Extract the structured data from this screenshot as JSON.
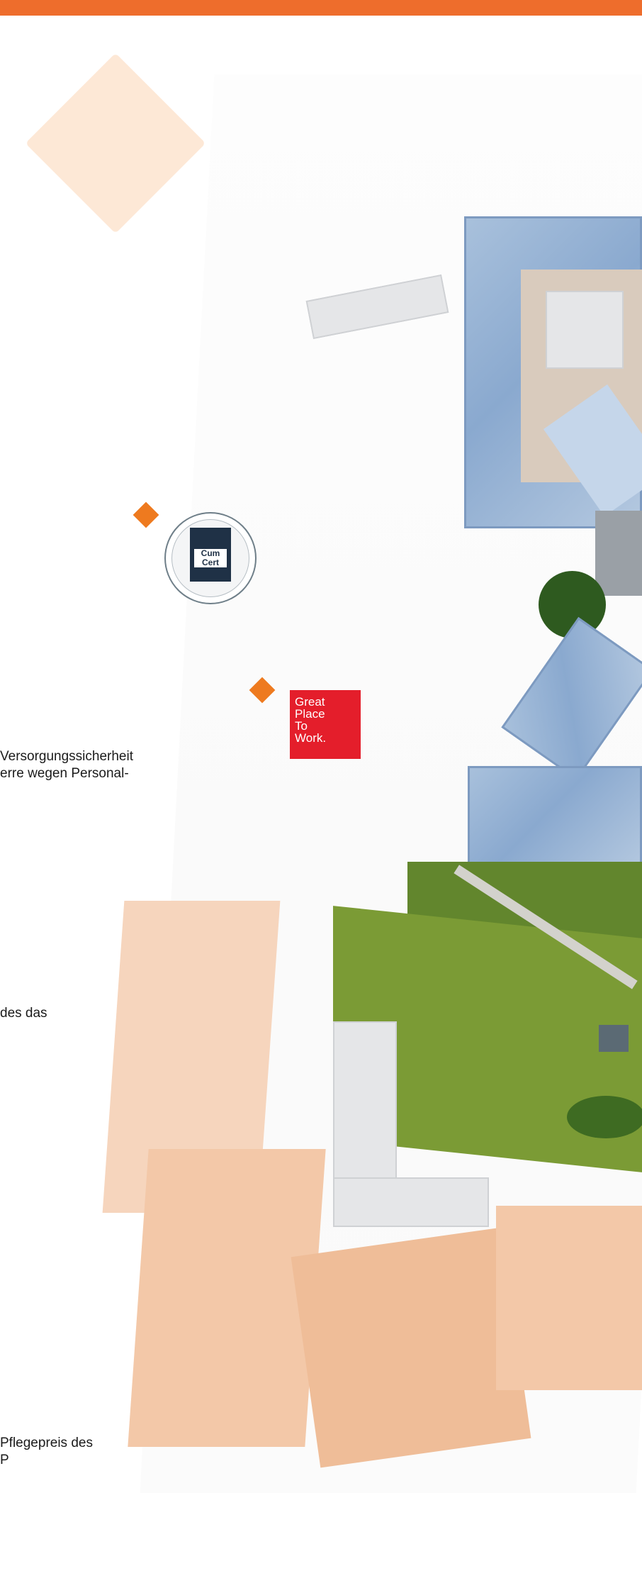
{
  "texts": {
    "line1": "Versorgungssicherheit",
    "line2": "erre wegen Personal-",
    "line3": "des das",
    "line4": "Pflegepreis des",
    "line5": "P"
  },
  "badges": {
    "seal_word_1": "Cum",
    "seal_word_2": "Cert",
    "gptw_line1": "Great",
    "gptw_line2": "Place",
    "gptw_line3": "To",
    "gptw_line4": "Work."
  },
  "colors": {
    "accent": "#ee6d2c",
    "diamond": "#ee7a1f",
    "decor": "#fde8d6",
    "gptw": "#e41e2b"
  }
}
